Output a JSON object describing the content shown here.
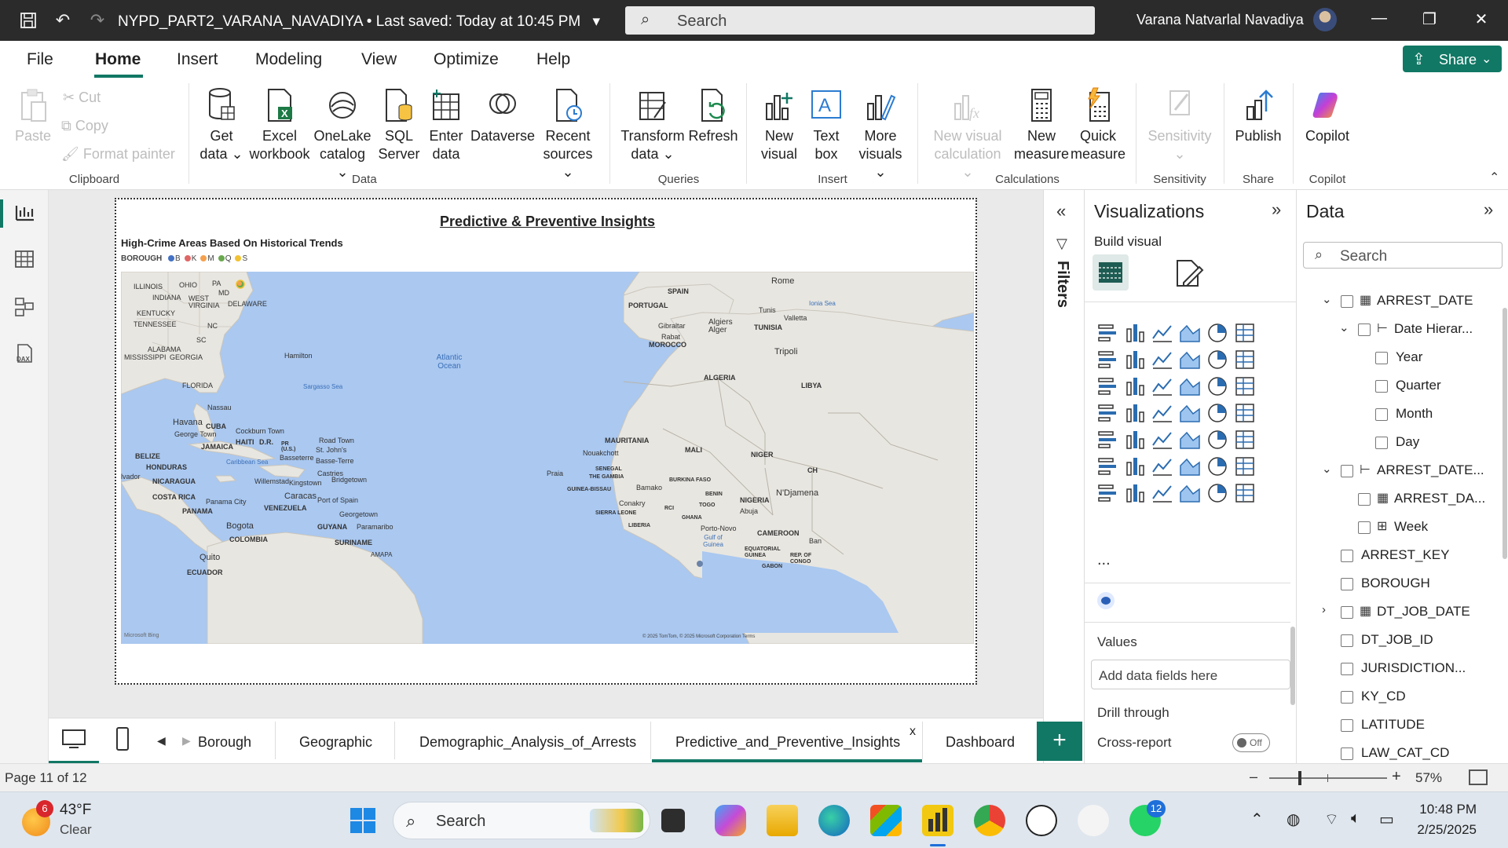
{
  "titlebar": {
    "doc_title": "NYPD_PART2_VARANA_NAVADIYA • Last saved: Today at 10:45 PM",
    "search_placeholder": "Search",
    "user_name": "Varana Natvarlal Navadiya"
  },
  "menu": {
    "items": [
      "File",
      "Home",
      "Insert",
      "Modeling",
      "View",
      "Optimize",
      "Help"
    ],
    "active": "Home",
    "share_label": "Share"
  },
  "ribbon": {
    "clipboard": {
      "paste": "Paste",
      "cut": "Cut",
      "copy": "Copy",
      "format_painter": "Format painter",
      "group": "Clipboard"
    },
    "data": {
      "get_data": "Get data",
      "excel": "Excel workbook",
      "onelake": "OneLake catalog",
      "sql": "SQL Server",
      "enter": "Enter data",
      "dataverse": "Dataverse",
      "recent": "Recent sources",
      "group": "Data"
    },
    "queries": {
      "transform": "Transform data",
      "refresh": "Refresh",
      "group": "Queries"
    },
    "insert": {
      "new_visual": "New visual",
      "text_box": "Text box",
      "more_visuals": "More visuals",
      "group": "Insert"
    },
    "calculations": {
      "new_visual_calc": "New visual calculation",
      "new_measure": "New measure",
      "quick_measure": "Quick measure",
      "group": "Calculations"
    },
    "sensitivity": {
      "label": "Sensitivity",
      "group": "Sensitivity"
    },
    "share": {
      "publish": "Publish",
      "group": "Share"
    },
    "copilot": {
      "label": "Copilot",
      "group": "Copilot"
    }
  },
  "report": {
    "page_title": "Predictive & Preventive Insights",
    "visual_title": "High-Crime Areas Based On Historical Trends",
    "legend_title": "BOROUGH",
    "legend_items": [
      {
        "label": "B",
        "color": "#4472c4"
      },
      {
        "label": "K",
        "color": "#e06666"
      },
      {
        "label": "M",
        "color": "#f6a04d"
      },
      {
        "label": "Q",
        "color": "#6aa84f"
      },
      {
        "label": "S",
        "color": "#f1c232"
      }
    ],
    "map_labels": {
      "illinois": "ILLINOIS",
      "ohio": "OHIO",
      "pa": "PA",
      "indiana": "INDIANA",
      "west_virginia": "WEST VIRGINIA",
      "md": "MD",
      "delaware": "DELAWARE",
      "kentucky": "KENTUCKY",
      "tennessee": "TENNESSEE",
      "nc": "NC",
      "sc": "SC",
      "alabama": "ALABAMA",
      "mississippi": "MISSISSIPPI",
      "georgia": "GEORGIA",
      "florida": "FLORIDA",
      "hamilton": "Hamilton",
      "atlantic": "Atlantic Ocean",
      "sargasso": "Sargasso Sea",
      "nassau": "Nassau",
      "havana": "Havana",
      "cuba": "CUBA",
      "george_town": "George Town",
      "cockburn": "Cockburn Town",
      "haiti": "HAITI",
      "dr": "D.R.",
      "jamaica": "JAMAICA",
      "belize": "BELIZE",
      "honduras": "HONDURAS",
      "salvador": "lvador",
      "nicaragua": "NICARAGUA",
      "costa_rica": "COSTA RICA",
      "panama": "PANAMA",
      "panama_city": "Panama City",
      "caribbean": "Caribbean Sea",
      "pr": "PR (U.S.)",
      "basseterre": "Basseterre",
      "road_town": "Road Town",
      "st_johns": "St. John's",
      "basse_terre": "Basse-Terre",
      "castries": "Castries",
      "kingstown": "Kingstown",
      "bridgetown": "Bridgetown",
      "willemstad": "Willemstad",
      "caracas": "Caracas",
      "port_spain": "Port of Spain",
      "venezuela": "VENEZUELA",
      "georgetown": "Georgetown",
      "guyana": "GUYANA",
      "paramaribo": "Paramaribo",
      "suriname": "SURINAME",
      "bogota": "Bogota",
      "colombia": "COLOMBIA",
      "quito": "Quito",
      "ecuador": "ECUADOR",
      "amapa": "AMAPA",
      "spain": "SPAIN",
      "portugal": "PORTUGAL",
      "rome": "Rome",
      "tunis": "Tunis",
      "valletta": "Valletta",
      "algiers": "Algiers Alger",
      "gibraltar": "Gibraltar",
      "rabat": "Rabat",
      "morocco": "MOROCCO",
      "tunisia": "TUNISIA",
      "tripoli": "Tripoli",
      "algeria": "ALGERIA",
      "libya": "LIBYA",
      "mauritania": "MAURITANIA",
      "nouakchott": "Nouakchott",
      "mali": "MALI",
      "niger": "NIGER",
      "chad": "CH",
      "senegal": "SENEGAL",
      "gambia": "THE GAMBIA",
      "praia": "Praia",
      "bamako": "Bamako",
      "burkina": "BURKINA FASO",
      "guinea_bissau": "GUINEA-BISSAU",
      "conakry": "Conakry",
      "sierra_leone": "SIERRA LEONE",
      "liberia": "LIBERIA",
      "rci": "RCI",
      "ghana": "GHANA",
      "togo": "TOGO",
      "benin": "BENIN",
      "nigeria": "NIGERIA",
      "abuja": "Abuja",
      "ndjamena": "N'Djamena",
      "cameroon": "CAMEROON",
      "porto_novo": "Porto-Novo",
      "gulf_guinea": "Gulf of Guinea",
      "eq_guinea": "EQUATORIAL GUINEA",
      "congo": "REP. OF CONGO",
      "gabon": "GABON",
      "ionian": "Ionia Sea",
      "bay": "Ban",
      "attribution": "© 2025 TomTom, © 2025 Microsoft Corporation  Terms",
      "bing": "Microsoft Bing"
    }
  },
  "filters": {
    "label": "Filters"
  },
  "visualizations": {
    "title": "Visualizations",
    "build_visual": "Build visual",
    "more": "...",
    "values_label": "Values",
    "values_placeholder": "Add data fields here",
    "drill_through": "Drill through",
    "cross_report": "Cross-report",
    "toggle": "Off"
  },
  "data": {
    "title": "Data",
    "search_placeholder": "Search",
    "fields": [
      {
        "label": "ARREST_DATE",
        "indent": 0,
        "chev": "⌄",
        "type": "table"
      },
      {
        "label": "Date Hierar...",
        "indent": 1,
        "chev": "⌄",
        "type": "hier"
      },
      {
        "label": "Year",
        "indent": 2,
        "chev": "",
        "type": ""
      },
      {
        "label": "Quarter",
        "indent": 2,
        "chev": "",
        "type": ""
      },
      {
        "label": "Month",
        "indent": 2,
        "chev": "",
        "type": ""
      },
      {
        "label": "Day",
        "indent": 2,
        "chev": "",
        "type": ""
      },
      {
        "label": "ARREST_DATE...",
        "indent": 0,
        "chev": "⌄",
        "type": "hier"
      },
      {
        "label": "ARREST_DA...",
        "indent": 1,
        "chev": "",
        "type": "table"
      },
      {
        "label": "Week",
        "indent": 1,
        "chev": "",
        "type": "calc"
      },
      {
        "label": "ARREST_KEY",
        "indent": 0,
        "chev": "",
        "type": ""
      },
      {
        "label": "BOROUGH",
        "indent": 0,
        "chev": "",
        "type": ""
      },
      {
        "label": "DT_JOB_DATE",
        "indent": 0,
        "chev": "›",
        "type": "table"
      },
      {
        "label": "DT_JOB_ID",
        "indent": 0,
        "chev": "",
        "type": ""
      },
      {
        "label": "JURISDICTION...",
        "indent": 0,
        "chev": "",
        "type": ""
      },
      {
        "label": "KY_CD",
        "indent": 0,
        "chev": "",
        "type": ""
      },
      {
        "label": "LATITUDE",
        "indent": 0,
        "chev": "",
        "type": ""
      },
      {
        "label": "LAW_CAT_CD",
        "indent": 0,
        "chev": "",
        "type": ""
      }
    ]
  },
  "tabs": {
    "items": [
      "Borough",
      "Geographic",
      "Demographic_Analysis_of_Arrests",
      "Predictive_and_Preventive_Insights",
      "Dashboard"
    ],
    "active": "Predictive_and_Preventive_Insights",
    "close": "x",
    "add": "+"
  },
  "status": {
    "page_count": "Page 11 of 12",
    "zoom": "57%",
    "zoom_level_percent": 57
  },
  "taskbar": {
    "weather_temp": "43°F",
    "weather_desc": "Clear",
    "weather_badge": "6",
    "search_placeholder": "Search",
    "whatsapp_badge": "12",
    "time": "10:48 PM",
    "date": "2/25/2025"
  }
}
